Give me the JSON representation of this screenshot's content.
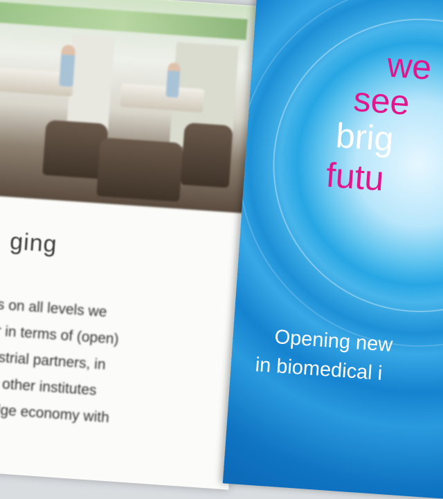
{
  "left_page": {
    "heading": "ging",
    "body_lines": [
      "ions on all levels we",
      "ther in terms of (open)",
      "ndustrial partners, in",
      "with other institutes",
      "wledge economy with"
    ]
  },
  "cover": {
    "tagline": [
      "we",
      "see",
      "brig",
      "futu"
    ],
    "subtitle_lines": [
      "Opening new",
      "in biomedical i"
    ],
    "colors": {
      "pink": "#e2168c",
      "blue": "#1583cf",
      "white": "#ffffff"
    }
  }
}
